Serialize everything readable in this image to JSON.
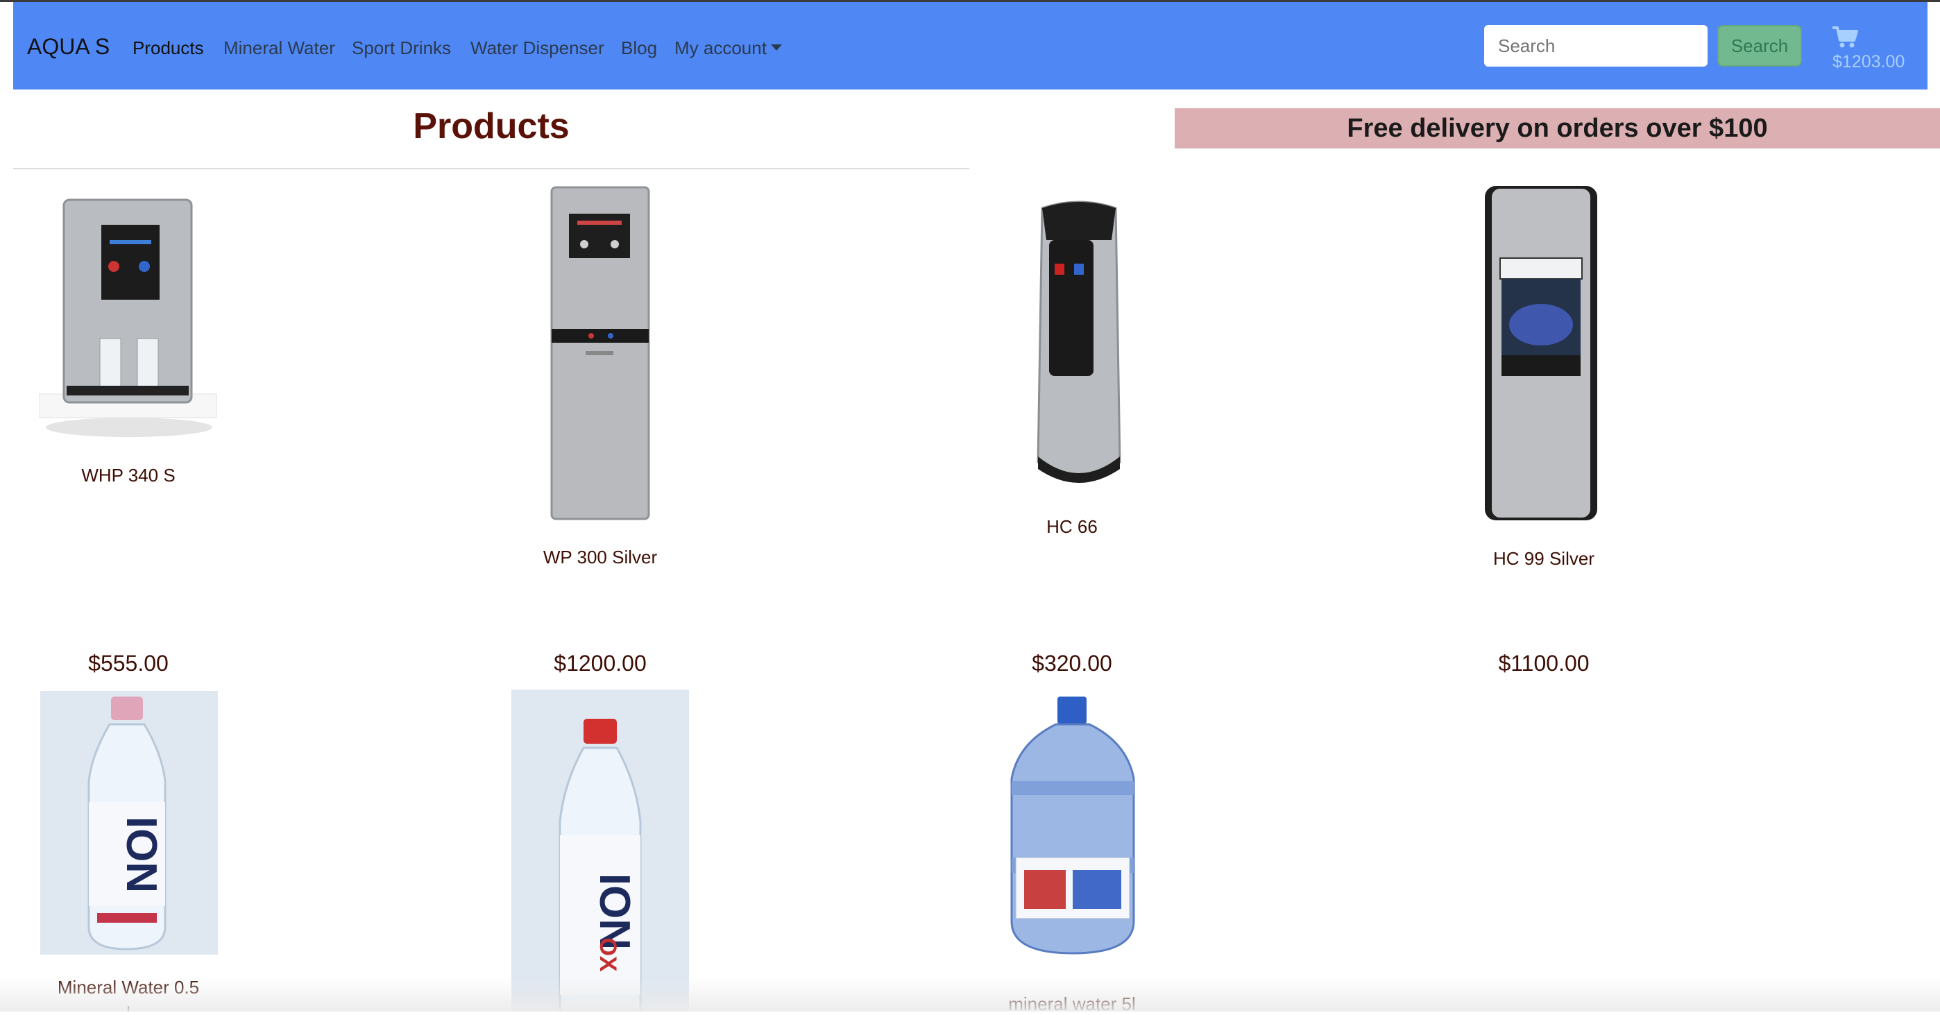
{
  "navbar": {
    "brand": "AQUA S",
    "links": [
      "Products",
      "Mineral Water",
      "Sport Drinks",
      "Water Dispenser",
      "Blog"
    ],
    "account_label": "My account",
    "search": {
      "placeholder": "Search",
      "button_label": "Search"
    },
    "cart": {
      "total": "$1203.00",
      "icon": "shopping-cart-icon"
    },
    "colors": {
      "background": "#4f87f5",
      "search_button": "#73b98f"
    }
  },
  "page": {
    "title": "Products",
    "banner": "Free delivery on orders over $100"
  },
  "products": [
    {
      "name": "WHP 340 S",
      "price": "$555.00"
    },
    {
      "name": "WP 300 Silver",
      "price": "$1200.00"
    },
    {
      "name": "HC 66",
      "price": "$320.00"
    },
    {
      "name": "HC 99 Silver",
      "price": "$1100.00"
    },
    {
      "name": "Mineral Water 0.5"
    },
    {
      "name": ""
    },
    {
      "name": "mineral water 5l"
    }
  ]
}
